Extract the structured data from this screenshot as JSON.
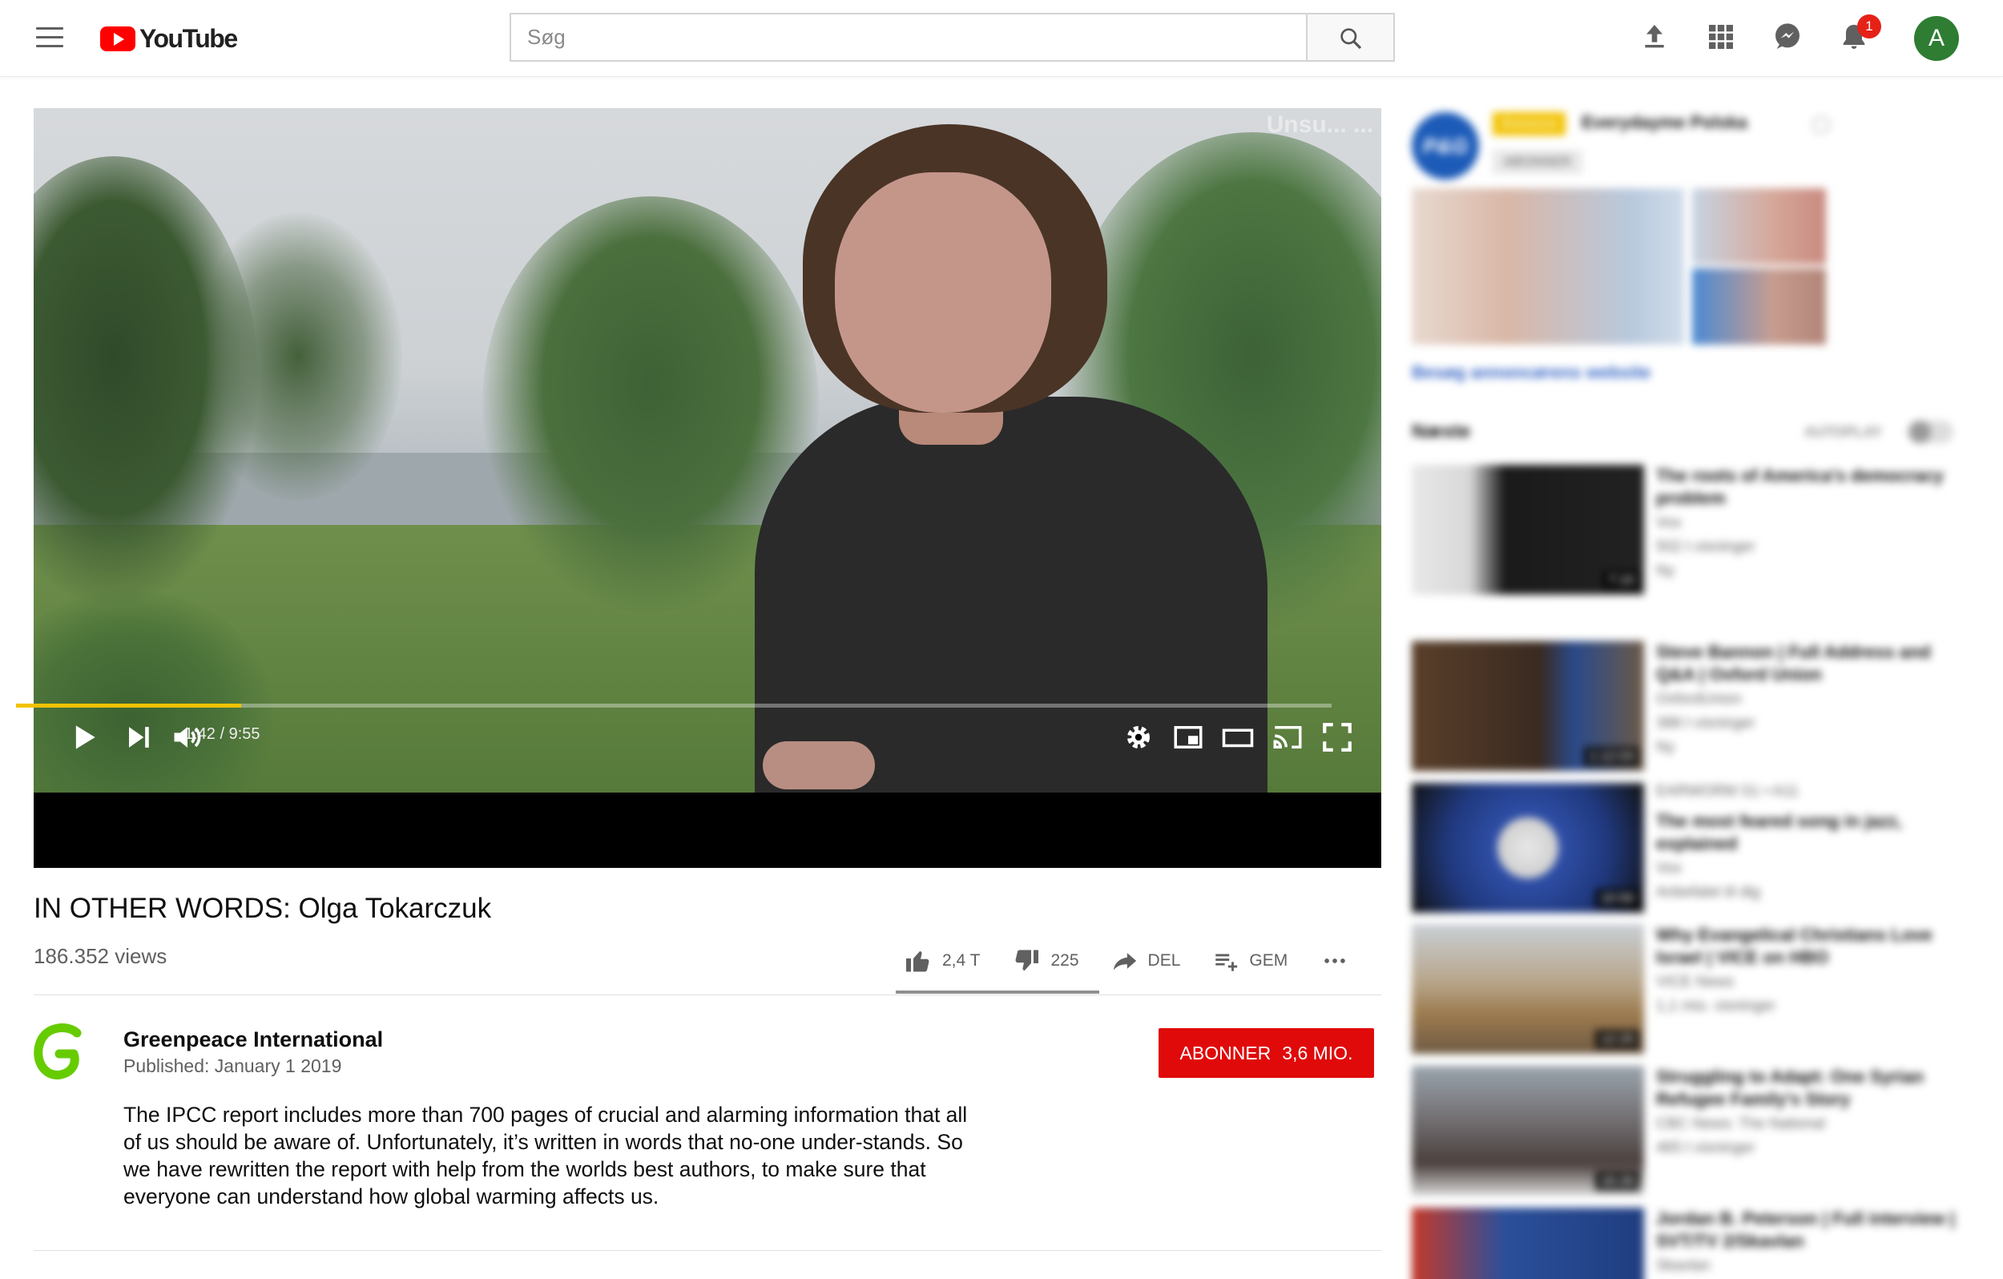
{
  "header": {
    "app_name": "YouTube",
    "search_placeholder": "Søg",
    "notification_count": "1",
    "avatar_initial": "A"
  },
  "player": {
    "watermark": "Unsu... ...",
    "current_time": "1:42",
    "duration": "9:55",
    "time_display": "1:42 / 9:55",
    "progress_fraction": 0.171,
    "progress_color": "#f2c200"
  },
  "video": {
    "title": "IN OTHER WORDS: Olga Tokarczuk",
    "views": "186.352 views",
    "likes": "2,4 T",
    "dislikes": "225",
    "share_label": "DEL",
    "save_label": "GEM",
    "like_ratio": 0.914
  },
  "channel": {
    "name": "Greenpeace International",
    "published": "Published: January 1 2019",
    "subscribe_label": "ABONNER",
    "subscriber_count": "3,6 MIO.",
    "brand_color": "#66cc00",
    "description": "The IPCC report includes more than 700 pages of crucial and alarming information that all of us should be aware of. Unfortunately, it’s written in words that no-one under-stands. So we have rewritten the report with help from the worlds best authors, to make sure that everyone can understand how global warming affects us."
  },
  "sidebar": {
    "ad": {
      "logo_text": "P&G",
      "tag": "Annonce",
      "advertiser": "Everydayme Polska",
      "subscribe_label": "ABONNER",
      "link": "Besøg annoncørens website"
    },
    "up_next_label": "Næste",
    "autoplay_label": "AUTOPLAY",
    "recommendations": [
      {
        "title": "The roots of America's democracy problem",
        "channel": "Vox",
        "views": "502 t visninger",
        "badge": "Ny",
        "duration": "7:10"
      },
      {
        "title": "Steve Bannon | Full Address and Q&A | Oxford Union",
        "channel": "OxfordUnion",
        "views": "388 t visninger",
        "badge": "Ny",
        "duration": "1:12:03"
      },
      {
        "title": "The most feared song in jazz, explained",
        "channel": "Vox",
        "views": "Anbefalet til dig",
        "badge": "EARWORM S1 • A11",
        "duration": "10:50"
      },
      {
        "title": "Why Evangelical Christians Love Israel | VICE on HBO",
        "channel": "VICE News",
        "views": "1,1 mio. visninger",
        "badge": "",
        "duration": "12:25"
      },
      {
        "title": "Struggling to Adapt: One Syrian Refugee Family's Story",
        "channel": "CBC News: The National",
        "views": "465 t visninger",
        "badge": "",
        "duration": "16:26"
      },
      {
        "title": "Jordan B. Peterson | Full interview | SVT/TV 2/Skavlan",
        "channel": "Skavlan",
        "views": "",
        "badge": "",
        "duration": ""
      }
    ]
  }
}
